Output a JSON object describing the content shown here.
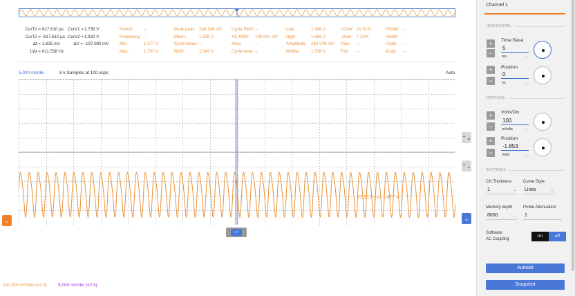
{
  "cursors": {
    "curt1_key": "CurT1 =",
    "curt1": "817.610 µs",
    "curt2_key": "CurT2 =",
    "curt2": "-817.610 µs",
    "dt_key": "Δt =",
    "dt": "1.635 ms",
    "inv_dt_key": "1/Δt =",
    "inv_dt": "611.538 Hz",
    "curv1_key": "CurV1 =",
    "curv1": "1.735 V",
    "curv2_key": "CurV2 =",
    "curv2": "1.932 V",
    "dv_key": "ΔV =",
    "dv": "-197.080 mV"
  },
  "measurements": {
    "period_key": "Period:",
    "period": "--",
    "frequency_key": "Frequency:",
    "frequency": "--",
    "min_key": "Min:",
    "min": "1.377 V",
    "max_key": "Max:",
    "max": "1.707 V",
    "peak_key": "Peak-peak:",
    "peak": "330.106 mV",
    "mean_key": "Mean:",
    "mean": "1.539 V",
    "cycle_mean_key": "Cycle Mean:",
    "cycle_mean": "--",
    "rms_key": "RMS:",
    "rms": "1.543 V",
    "cycle_rms_key": "Cycle RMS:",
    "cycle_rms": "--",
    "ac_rms_key": "AC RMS:",
    "ac_rms": "109.941 mV",
    "area_key": "Area:",
    "area": "--",
    "cycle_area_key": "Cycle Area:",
    "cycle_area": "--",
    "low_key": "Low:",
    "low": "1.396 V",
    "high_key": "High:",
    "high": "1.656 V",
    "amplitude_key": "Amplitude:",
    "amplitude": "260.276 mV",
    "middle_key": "Middle:",
    "middle": "1.526 V",
    "pos_over_key": "+Over:",
    "pos_over": "19.51%",
    "neg_over_key": "-Over:",
    "neg_over": "7.32%",
    "rise_key": "Rise:",
    "rise": "--",
    "fall_key": "Fall:",
    "fall": "--",
    "pos_width_key": "+Width:",
    "pos_width": "--",
    "neg_width_key": "-Width:",
    "neg_width": "--",
    "pos_duty_key": "+Duty:",
    "pos_duty": "--",
    "neg_duty_key": "-Duty:",
    "neg_duty": "--"
  },
  "scope": {
    "scale_label": "5.000 ms/div",
    "samples_label": "8 k Samples at 100 ksps",
    "trigger_mode": "Auto",
    "cursor_readout": "22.013 ms, 1.477 V",
    "expand_right_icon": "chevron-down",
    "expand_left_icon": "chevron-down",
    "drag_handle_label": "‹ ›",
    "updown_glyph": "⌃⌄"
  },
  "channel_labels": {
    "ch1": "100.000 mV/div (±2.5)",
    "ch2": "5.000 mV/div (±2.5)"
  },
  "sidebar": {
    "title": "Channel 1",
    "horizontal_section": "HORIZONTAL",
    "time_base_label": "Time Base",
    "time_base_value": "5",
    "time_base_unit": "ms",
    "h_position_label": "Position",
    "h_position_value": "0",
    "h_position_unit": "ns",
    "vertical_section": "VERTICAL",
    "volts_div_label": "Volts/Div",
    "volts_div_value": "100",
    "volts_div_unit": "mVolts",
    "v_position_label": "Position",
    "v_position_value": "-1.853",
    "v_position_unit": "Volts",
    "settings_section": "SETTINGS",
    "ch_thickness_label": "CH Thickness",
    "ch_thickness_value": "1",
    "curve_style_label": "Curve Style",
    "curve_style_value": "Lines",
    "memory_depth_label": "Memory depth",
    "memory_depth_value": "8000",
    "probe_attenuation_label": "Probe Attenuation",
    "probe_attenuation_value": "1",
    "software_label": "Software",
    "ac_coupling_label": "AC Coupling",
    "toggle_on": "on",
    "toggle_off": "off",
    "autoset_label": "Autoset",
    "snapshot_label": "Snapshot",
    "plus_glyph": "+",
    "minus_glyph": "−",
    "chev_glyph": "⌄"
  },
  "colors": {
    "ch1": "#e8923a",
    "ch2": "#9b36d1",
    "accent": "#4a78d8",
    "orange_accent": "#f08028"
  }
}
